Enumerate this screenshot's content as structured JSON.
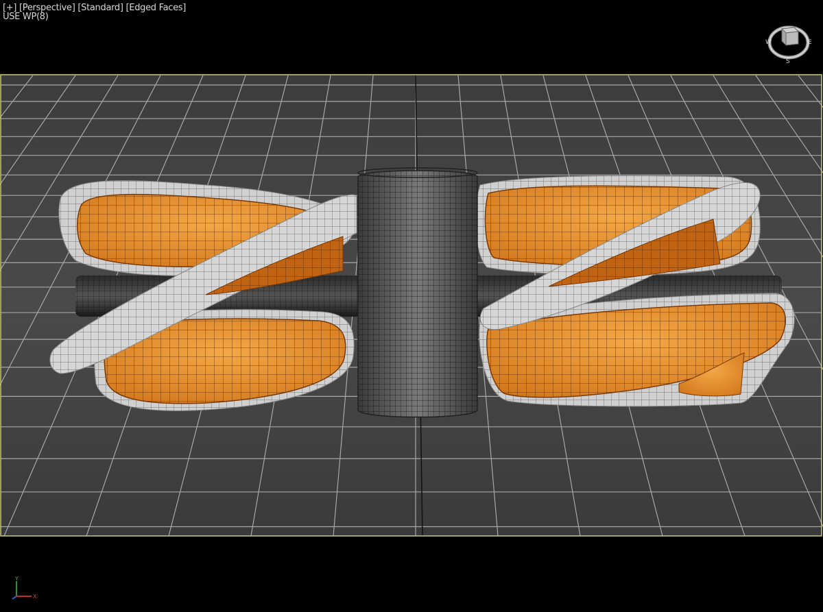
{
  "viewport": {
    "label_plus": "[+]",
    "label_view": "[Perspective]",
    "label_shading": "[Standard]",
    "label_edges": "[Edged Faces]",
    "subtitle": "USE WP(8)",
    "frame_color": "#c8cc6a",
    "background_color": "#000000",
    "grid_color": "#b4b4b4",
    "surface_color": "#e8922a",
    "shell_color": "#c8c8c8",
    "wheel_color": "#5a5a5a"
  },
  "viewcube": {
    "icon": "viewcube-icon",
    "compass_w": "W",
    "compass_e": "E",
    "compass_s": "S"
  },
  "axis": {
    "icon": "axis-tripod-icon",
    "y_label": "Y",
    "x_label": "X"
  }
}
